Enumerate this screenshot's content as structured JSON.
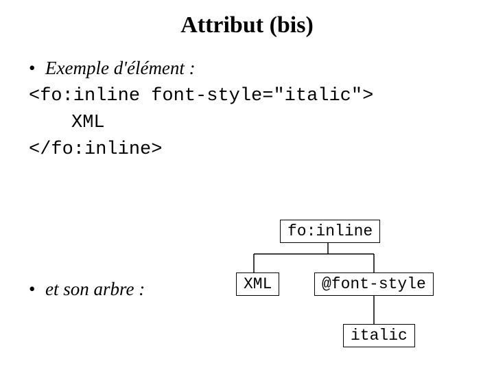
{
  "title": "Attribut (bis)",
  "bullets": {
    "example": "Exemple d'élément :",
    "tree": "et son arbre :"
  },
  "code": {
    "open_lt": "<",
    "open_tag": "fo:inline font-style=\"italic\"",
    "open_gt": ">",
    "content": "XML",
    "close_lt": "</",
    "close_tag": "fo:inline",
    "close_gt": ">"
  },
  "tree": {
    "root": "fo:inline",
    "child_text": "XML",
    "child_attr": "@font-style",
    "attr_value": "italic"
  }
}
